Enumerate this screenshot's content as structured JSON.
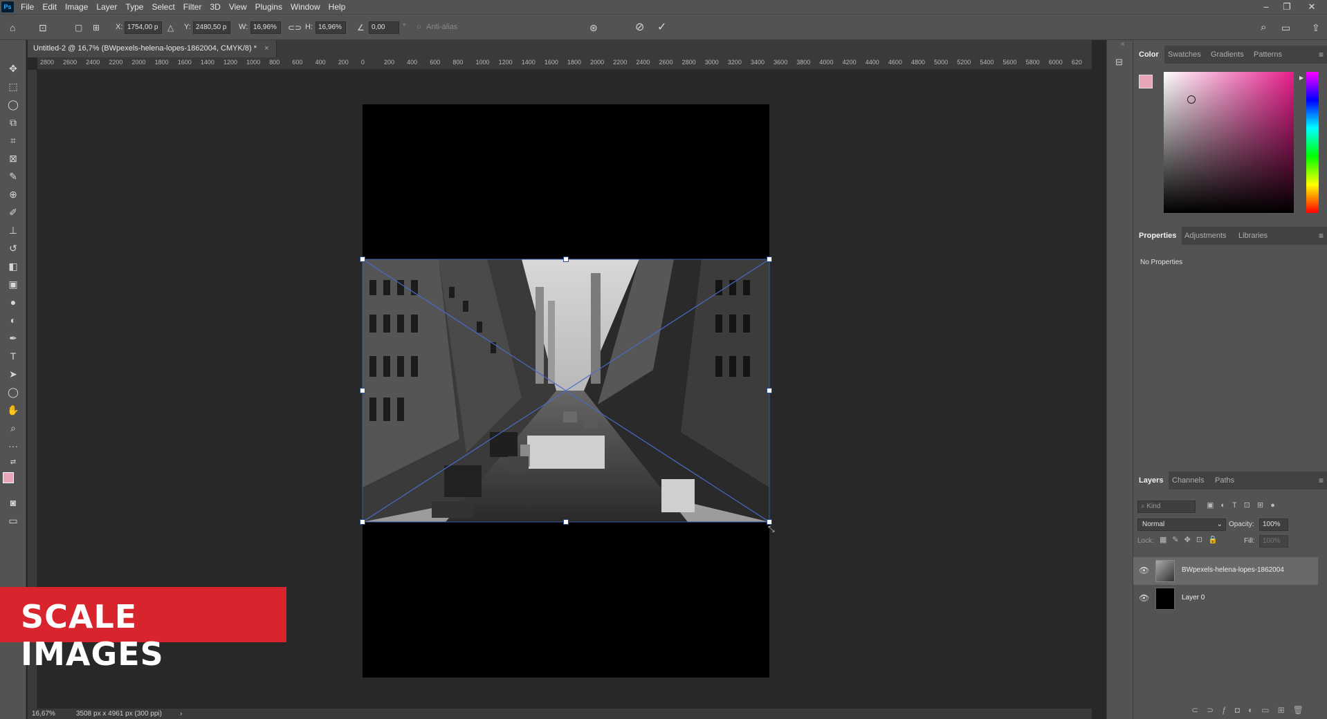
{
  "menubar": {
    "items": [
      "File",
      "Edit",
      "Image",
      "Layer",
      "Type",
      "Select",
      "Filter",
      "3D",
      "View",
      "Plugins",
      "Window",
      "Help"
    ]
  },
  "options": {
    "x_label": "X:",
    "x_value": "1754,00 p",
    "y_label": "Y:",
    "y_value": "2480,50 p",
    "w_label": "W:",
    "w_value": "16,96%",
    "h_label": "H:",
    "h_value": "16,96%",
    "angle_value": "0,00",
    "angle_unit": "°",
    "antialias_label": "Anti-alias"
  },
  "document": {
    "tab_title": "Untitled-2 @ 16,7% (BWpexels-helena-lopes-1862004, CMYK/8) *",
    "close": "×"
  },
  "ruler": {
    "h_ticks": [
      "2800",
      "2600",
      "2400",
      "2200",
      "2000",
      "1800",
      "1600",
      "1400",
      "1200",
      "1000",
      "800",
      "600",
      "400",
      "200",
      "0",
      "200",
      "400",
      "600",
      "800",
      "1000",
      "1200",
      "1400",
      "1600",
      "1800",
      "2000",
      "2200",
      "2400",
      "2600",
      "2800",
      "3000",
      "3200",
      "3400",
      "3600",
      "3800",
      "4000",
      "4200",
      "4400",
      "4600",
      "4800",
      "5000",
      "5200",
      "5400",
      "5600",
      "5800",
      "6000",
      "620"
    ]
  },
  "overlay": {
    "banner_text": "SCALE IMAGES"
  },
  "status": {
    "zoom": "16,67%",
    "doc_info": "3508 px x 4961 px (300 ppi)",
    "arrow": "›"
  },
  "panels": {
    "color_tabs": [
      "Color",
      "Swatches",
      "Gradients",
      "Patterns"
    ],
    "properties_tabs": [
      "Properties",
      "Adjustments",
      "Libraries"
    ],
    "properties_text": "No Properties",
    "layers_tabs": [
      "Layers",
      "Channels",
      "Paths"
    ],
    "kind_placeholder": "Kind",
    "blend_mode": "Normal",
    "opacity_label": "Opacity:",
    "opacity_value": "100%",
    "lock_label": "Lock:",
    "fill_label": "Fill:",
    "fill_value": "100%",
    "layers": [
      {
        "name": "BWpexels-helena-lopes-1862004"
      },
      {
        "name": "Layer 0"
      }
    ]
  },
  "colors": {
    "foreground": "#e8a6b8",
    "accent_pink": "#e81e8c"
  }
}
